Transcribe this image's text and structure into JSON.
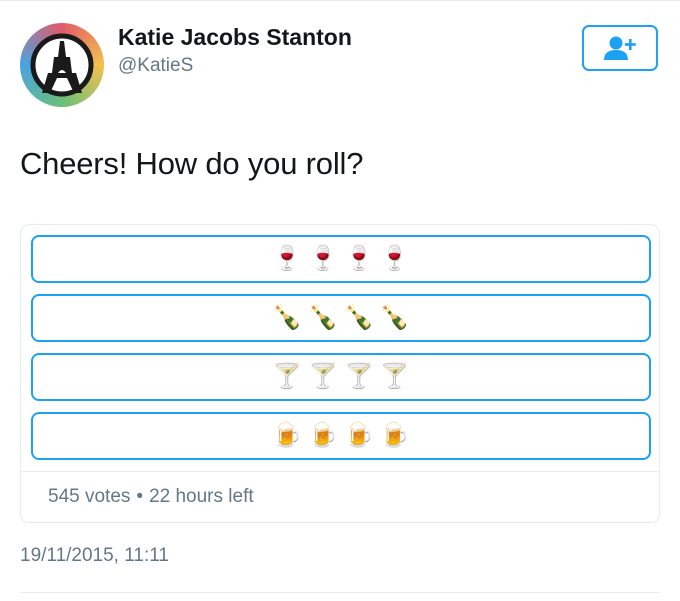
{
  "author": {
    "name": "Katie Jacobs Stanton",
    "handle": "@KatieS"
  },
  "follow_button": {
    "icon": "add-user-icon"
  },
  "tweet": {
    "text": "Cheers! How do you roll?",
    "timestamp": "19/11/2015, 11:11"
  },
  "poll": {
    "options": [
      {
        "label": "🍷🍷🍷🍷"
      },
      {
        "label": "🍾🍾🍾🍾"
      },
      {
        "label": "🍸🍸🍸🍸"
      },
      {
        "label": "🍺🍺🍺🍺"
      }
    ],
    "votes": "545 votes",
    "separator": "•",
    "time_left": "22 hours left"
  },
  "colors": {
    "accent": "#1da1f2",
    "secondary_text": "#657786",
    "border": "#e6ecf0"
  }
}
